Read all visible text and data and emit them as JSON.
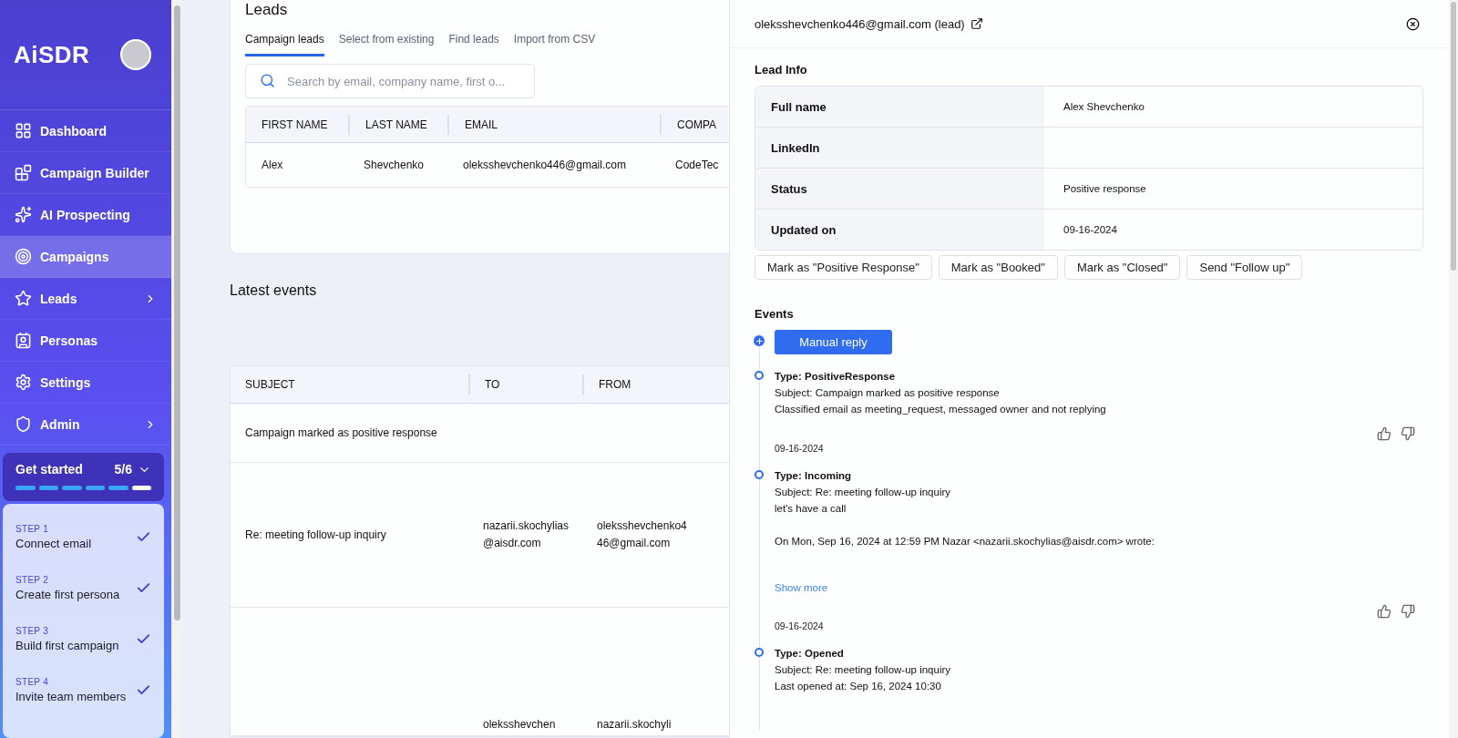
{
  "sidebar": {
    "logo": "AiSDR",
    "nav": [
      {
        "label": "Dashboard",
        "selected": false,
        "submenu": false
      },
      {
        "label": "Campaign Builder",
        "selected": false,
        "submenu": false
      },
      {
        "label": "AI Prospecting",
        "selected": false,
        "submenu": false
      },
      {
        "label": "Campaigns",
        "selected": true,
        "submenu": false
      },
      {
        "label": "Leads",
        "selected": false,
        "submenu": true
      },
      {
        "label": "Personas",
        "selected": false,
        "submenu": false
      },
      {
        "label": "Settings",
        "selected": false,
        "submenu": false
      },
      {
        "label": "Admin",
        "selected": false,
        "submenu": true
      }
    ],
    "get_started": {
      "title": "Get started",
      "count": "5/6",
      "expanded": true,
      "progress": [
        {
          "done": true
        },
        {
          "done": true
        },
        {
          "done": true
        },
        {
          "done": true
        },
        {
          "done": true
        },
        {
          "done": false
        }
      ],
      "steps": [
        {
          "step": "STEP 1",
          "label": "Connect email",
          "checked": true
        },
        {
          "step": "STEP 2",
          "label": "Create first persona",
          "checked": true
        },
        {
          "step": "STEP 3",
          "label": "Build first campaign",
          "checked": true
        },
        {
          "step": "STEP 4",
          "label": "Invite team members",
          "checked": true
        }
      ]
    }
  },
  "leads_card": {
    "title": "Leads",
    "tabs": [
      {
        "label": "Campaign leads",
        "selected": true
      },
      {
        "label": "Select from existing",
        "selected": false
      },
      {
        "label": "Find leads",
        "selected": false
      },
      {
        "label": "Import from CSV",
        "selected": false
      }
    ],
    "search": {
      "placeholder": "Search by email, company name, first o..."
    },
    "table": {
      "columns": [
        "FIRST NAME",
        "LAST NAME",
        "EMAIL",
        "COMPA"
      ],
      "rows": [
        [
          "Alex",
          "Shevchenko",
          "oleksshevchenko446@gmail.com",
          "CodeTec"
        ]
      ]
    }
  },
  "latest_events": {
    "title": "Latest events",
    "table": {
      "columns": [
        "SUBJECT",
        "TO",
        "FROM"
      ],
      "rows": [
        [
          "Campaign marked as positive response",
          "",
          ""
        ],
        [
          "Re: meeting follow-up inquiry",
          "nazarii.skochylias@aisdr.com",
          "oleksshevchenko446@gmail.com"
        ],
        [
          "",
          "oleksshevchen",
          "nazarii.skochyli"
        ]
      ]
    }
  },
  "drawer": {
    "title": "oleksshevchenko446@gmail.com (lead)",
    "lead_info_title": "Lead Info",
    "lead_info": [
      {
        "label": "Full name",
        "value": "Alex Shevchenko"
      },
      {
        "label": "LinkedIn"
      },
      {
        "label": "Status",
        "value": "Positive response"
      },
      {
        "label": "Updated on",
        "value": "09-16-2024"
      }
    ],
    "actions": [
      "Mark as \"Positive Response\"",
      "Mark as \"Booked\"",
      "Mark as \"Closed\"",
      "Send \"Follow up\""
    ],
    "events_title": "Events",
    "manual_reply": "Manual reply",
    "events": [
      {
        "type": "Type: PositiveResponse",
        "subject": "Subject: Campaign marked as positive response",
        "paragraphs": [
          "Classified email as meeting_request, messaged owner and not replying"
        ],
        "date": "09-16-2024",
        "rating": true
      },
      {
        "type": "Type: Incoming",
        "subject": "Subject: Re: meeting follow-up inquiry",
        "paragraphs": [
          "let's have a call",
          "On Mon, Sep 16, 2024 at 12:59 PM Nazar <nazarii.skochylias@aisdr.com> wrote:"
        ],
        "show_more": "Show more",
        "date": "09-16-2024",
        "rating": true
      },
      {
        "type": "Type: Opened",
        "subject": "Subject: Re: meeting follow-up inquiry",
        "paragraphs": [
          "Last opened at: Sep 16, 2024 10:30"
        ]
      }
    ]
  }
}
